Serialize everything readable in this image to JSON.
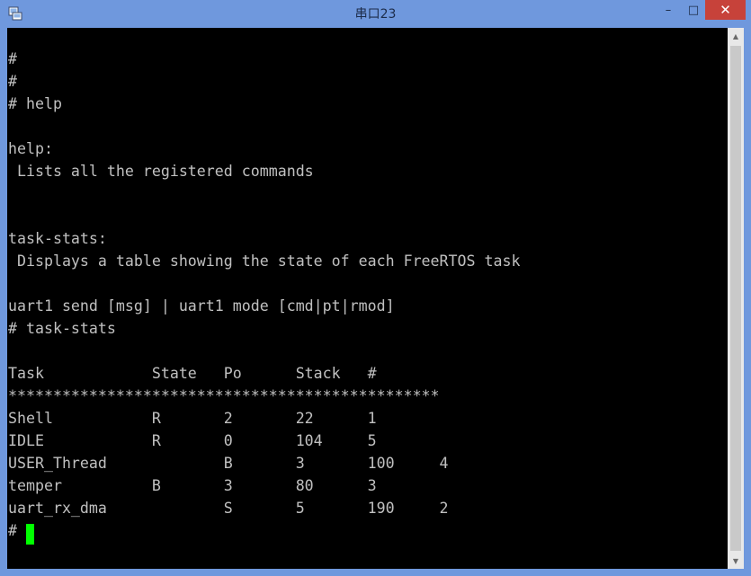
{
  "window": {
    "title": "串口23",
    "app_icon": "terminal-app-icon",
    "controls": {
      "minimize": "–",
      "maximize": "□",
      "close": "✕"
    }
  },
  "colors": {
    "titlebar": "#6f98dd",
    "close": "#c7423a",
    "terminal_bg": "#000000",
    "terminal_fg": "#c0c0c0",
    "cursor": "#00ff00"
  },
  "terminal": {
    "lines": [
      "",
      "#",
      "#",
      "# help",
      "",
      "help:",
      " Lists all the registered commands",
      "",
      "",
      "task-stats:",
      " Displays a table showing the state of each FreeRTOS task",
      "",
      "uart1 send [msg] | uart1 mode [cmd|pt|rmod]",
      "# task-stats",
      "",
      "Task            State   Po      Stack   #",
      "************************************************",
      "Shell           R       2       22      1",
      "IDLE            R       0       104     5",
      "USER_Thread             B       3       100     4",
      "temper          B       3       80      3",
      "uart_rx_dma             S       5       190     2",
      "# "
    ]
  }
}
